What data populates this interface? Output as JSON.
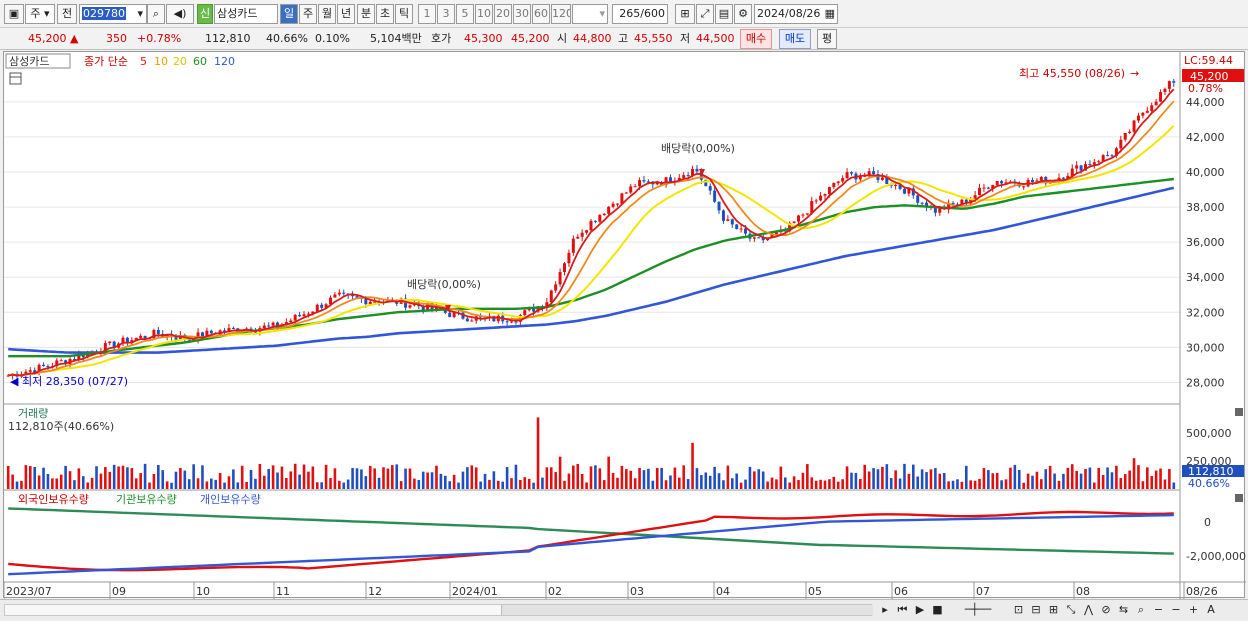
{
  "toolbar": {
    "type_label": "주",
    "prev_label": "전",
    "code": "029780",
    "credit_badge": "신",
    "stock_name": "삼성카드",
    "periods": [
      "일",
      "주",
      "월",
      "년",
      "분",
      "초",
      "틱"
    ],
    "active_period": "일",
    "intervals": [
      "1",
      "3",
      "5",
      "10",
      "20",
      "30",
      "60",
      "120"
    ],
    "count_current": "265",
    "count_total": "/600",
    "date": "2024/08/26"
  },
  "quote": {
    "price": "45,200",
    "change": "350",
    "change_pct": "+0.78%",
    "volume": "112,810",
    "vol_ratio": "40.66%",
    "turnover": "0.10%",
    "value": "5,104백만",
    "ask_label": "호가",
    "ask": "45,300",
    "bid": "45,200",
    "open_label": "시",
    "open": "44,800",
    "high_label": "고",
    "high": "45,550",
    "low_label": "저",
    "low": "44,500",
    "buy_button": "매수",
    "sell_button": "매도",
    "eval_button": "평"
  },
  "price_panel": {
    "name": "삼성카드",
    "legend_title": "종가 단순",
    "ma": [
      "5",
      "10",
      "20",
      "60",
      "120"
    ],
    "ma_colors": [
      "#d81b1b",
      "#f08a1c",
      "#f2e600",
      "#1d8f24",
      "#3256d8"
    ],
    "lc": "LC:59.44",
    "badge_price": "45,200",
    "badge_pct": "0.78%",
    "high_note": "최고 45,550 (08/26)",
    "low_note": "최저 28,350 (07/27)",
    "dividend_1": "배당락(0,00%)",
    "dividend_2": "배당락(0,00%)"
  },
  "volume_panel": {
    "title": "거래량",
    "info": "112,810주(40.66%)",
    "badge_vol": "112,810",
    "badge_pct": "40.66%"
  },
  "holding_panel": {
    "foreign": "외국인보유수량",
    "inst": "기관보유수량",
    "retail": "개인보유수량"
  },
  "chart_data": {
    "type": "line",
    "title": "삼성카드",
    "x_labels": [
      "2023/07",
      "09",
      "10",
      "11",
      "12",
      "2024/01",
      "02",
      "03",
      "04",
      "05",
      "06",
      "07",
      "08",
      "08/26"
    ],
    "y_ticks": [
      "44,000",
      "42,000",
      "40,000",
      "38,000",
      "36,000",
      "34,000",
      "32,000",
      "30,000",
      "28,000"
    ],
    "ylim": [
      27000,
      46500
    ],
    "price_series": [
      {
        "name": "종가",
        "values": [
          28400,
          28800,
          29300,
          29900,
          30400,
          30800,
          30500,
          30900,
          31100,
          31200,
          32000,
          32900,
          32700,
          32600,
          32300,
          31800,
          31600,
          31700,
          32600,
          36400,
          37900,
          39300,
          39500,
          40200,
          37200,
          36000,
          36600,
          38300,
          39800,
          39800,
          39000,
          37800,
          38300,
          39500,
          39400,
          39600,
          40400,
          41100,
          43500,
          45200
        ]
      },
      {
        "name": "60",
        "values": [
          29500,
          29500,
          29500,
          29700,
          29900,
          30100,
          30300,
          30600,
          30900,
          31100,
          31300,
          31600,
          31800,
          32000,
          32100,
          32200,
          32200,
          32200,
          32300,
          32700,
          33300,
          34100,
          34900,
          35600,
          36100,
          36400,
          36700,
          37200,
          37700,
          38000,
          38100,
          38000,
          37900,
          38200,
          38600,
          38800,
          39000,
          39200,
          39400,
          39600
        ]
      },
      {
        "name": "120",
        "values": [
          29900,
          29800,
          29700,
          29700,
          29700,
          29700,
          29800,
          29900,
          30000,
          30100,
          30300,
          30500,
          30600,
          30800,
          30900,
          31000,
          31100,
          31200,
          31300,
          31500,
          31800,
          32200,
          32600,
          33100,
          33600,
          34000,
          34400,
          34800,
          35200,
          35500,
          35800,
          36100,
          36400,
          36700,
          37100,
          37500,
          37900,
          38300,
          38700,
          39100
        ]
      }
    ],
    "volume_ticks": [
      "500,000",
      "250,000"
    ],
    "holding_ticks": [
      "0",
      "-2,000,000"
    ]
  }
}
